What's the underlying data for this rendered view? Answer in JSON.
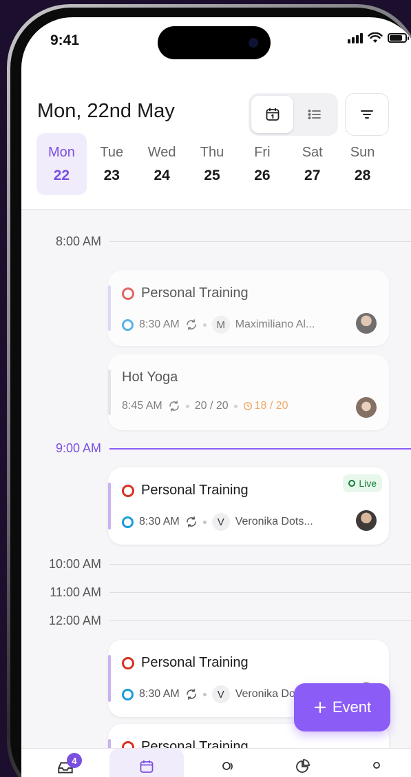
{
  "status_bar": {
    "time": "9:41"
  },
  "header": {
    "title": "Mon, 22nd May"
  },
  "week": [
    {
      "name": "Mon",
      "num": "22",
      "selected": true
    },
    {
      "name": "Tue",
      "num": "23"
    },
    {
      "name": "Wed",
      "num": "24"
    },
    {
      "name": "Thu",
      "num": "25"
    },
    {
      "name": "Fri",
      "num": "26"
    },
    {
      "name": "Sat",
      "num": "27"
    },
    {
      "name": "Sun",
      "num": "28"
    }
  ],
  "hours": [
    "8:00 AM",
    "9:00 AM",
    "10:00 AM",
    "11:00 AM",
    "12:00 AM"
  ],
  "events": [
    {
      "title": "Personal Training",
      "time": "8:30 AM",
      "initial": "M",
      "person": "Maximiliano Al..."
    },
    {
      "title": "Hot Yoga",
      "time": "8:45 AM",
      "capacity": "20 / 20",
      "waitlist": "18 / 20"
    },
    {
      "title": "Personal Training",
      "time": "8:30 AM",
      "initial": "V",
      "person": "Veronika Dots...",
      "badge": "Live"
    },
    {
      "title": "Personal Training",
      "time": "8:30 AM",
      "initial": "V",
      "person": "Veronika Dots..."
    },
    {
      "title": "Personal Training"
    }
  ],
  "fab": {
    "label": "Event"
  },
  "tabbar": {
    "badge_count": "4"
  },
  "colors": {
    "accent": "#8b5cf6",
    "accent_soft": "#f1ecfc",
    "live_green": "#12813b",
    "ring_red": "#d93025",
    "ring_blue": "#1a9bdc",
    "waitlist_orange": "#f08a2c"
  }
}
